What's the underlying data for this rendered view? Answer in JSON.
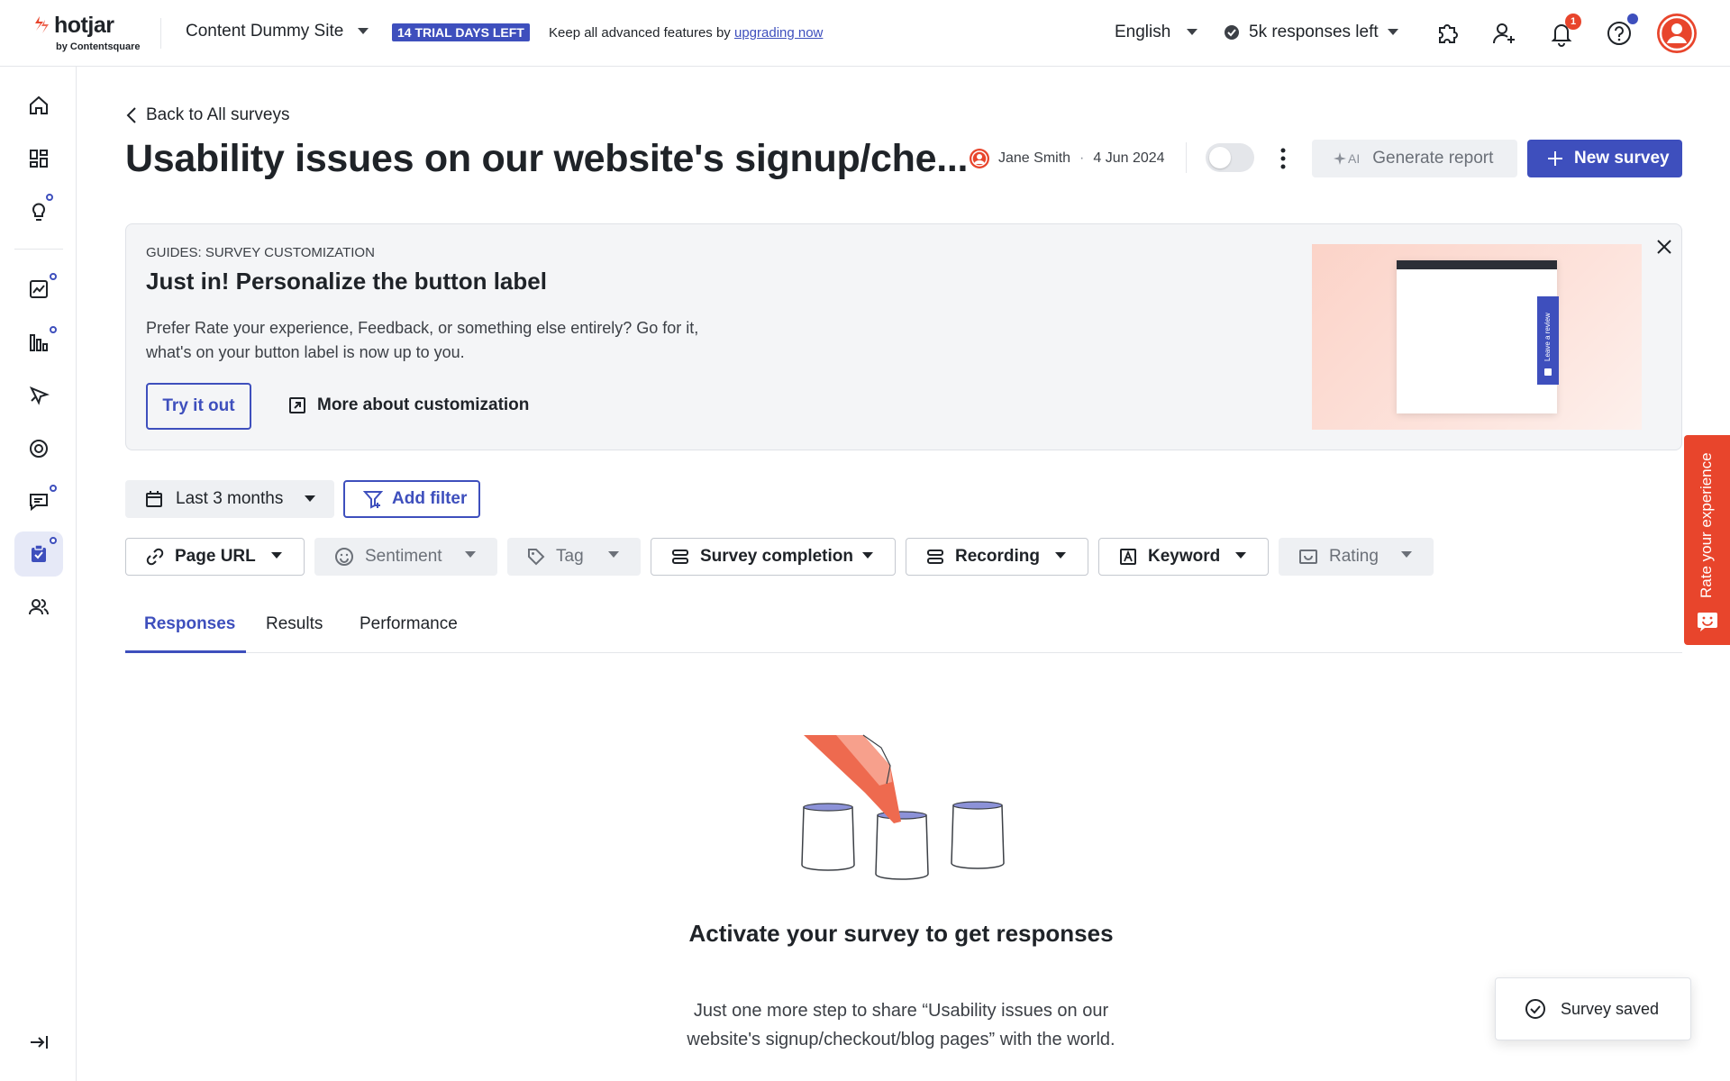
{
  "app": {
    "logo_name": "hotjar",
    "logo_by": "by Contentsquare"
  },
  "topbar": {
    "site_name": "Content Dummy Site",
    "trial_badge": "14 TRIAL DAYS LEFT",
    "trial_text": "Keep all advanced features by ",
    "trial_link": "upgrading now",
    "language": "English",
    "responses_left": "5k responses left",
    "notification_count": "1",
    "colors": {
      "accent": "#3e4fbd",
      "brand": "#e8452c"
    }
  },
  "header": {
    "back_label": "Back to All surveys",
    "title": "Usability issues on our website's signup/che...",
    "owner": "Jane Smith",
    "date": "4 Jun 2024",
    "survey_active": false,
    "ai_label": "AI",
    "generate_report": "Generate report",
    "new_survey": "New survey"
  },
  "guide": {
    "label": "GUIDES: SURVEY CUSTOMIZATION",
    "title": "Just in! Personalize the button label",
    "description": "Prefer Rate your experience, Feedback, or something else entirely? Go for it, what's on your button label is now up to you.",
    "try_button": "Try it out",
    "more_link": "More about customization",
    "preview_tab_text": "Leave a review"
  },
  "filters": {
    "date_range": "Last 3 months",
    "add_filter": "Add filter",
    "chips": [
      {
        "label": "Page URL",
        "icon": "link-icon",
        "enabled": true
      },
      {
        "label": "Sentiment",
        "icon": "smiley-icon",
        "enabled": false
      },
      {
        "label": "Tag",
        "icon": "tag-icon",
        "enabled": false
      },
      {
        "label": "Survey completion",
        "icon": "list-icon",
        "enabled": true
      },
      {
        "label": "Recording",
        "icon": "recording-icon",
        "enabled": true
      },
      {
        "label": "Keyword",
        "icon": "keyword-icon",
        "enabled": true
      },
      {
        "label": "Rating",
        "icon": "rating-icon",
        "enabled": false
      }
    ]
  },
  "tabs": [
    {
      "label": "Responses",
      "active": true
    },
    {
      "label": "Results",
      "active": false
    },
    {
      "label": "Performance",
      "active": false
    }
  ],
  "empty_state": {
    "title": "Activate your survey to get responses",
    "description": "Just one more step to share “Usability issues on our website's signup/checkout/blog pages” with the world."
  },
  "rate_tab": {
    "label": "Rate your experience"
  },
  "toast": {
    "message": "Survey saved"
  },
  "sidebar": {
    "items": [
      {
        "name": "home-icon"
      },
      {
        "name": "dashboards-icon"
      },
      {
        "name": "insights-icon"
      },
      {
        "name": "trends-icon"
      },
      {
        "name": "funnels-icon"
      },
      {
        "name": "heatmaps-icon"
      },
      {
        "name": "recordings-icon"
      },
      {
        "name": "feedback-icon"
      },
      {
        "name": "surveys-icon"
      },
      {
        "name": "interviews-icon"
      },
      {
        "name": "collapse-sidebar-icon"
      }
    ]
  }
}
